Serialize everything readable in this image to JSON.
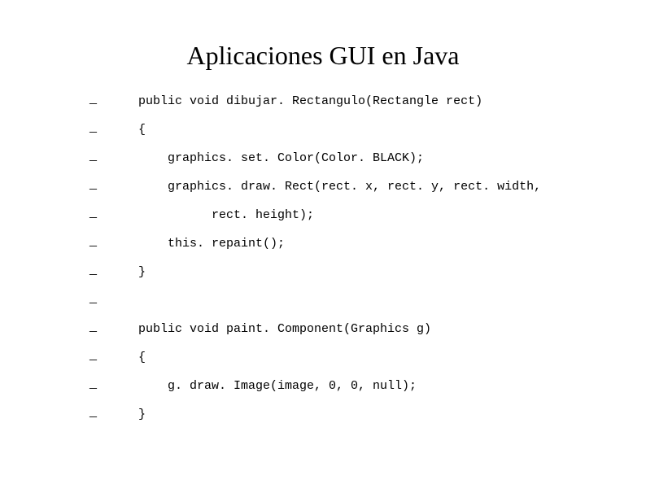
{
  "title": "Aplicaciones GUI en Java",
  "lines": [
    "public void dibujar. Rectangulo(Rectangle rect)",
    "{",
    "    graphics. set. Color(Color. BLACK);",
    "    graphics. draw. Rect(rect. x, rect. y, rect. width,",
    "          rect. height);",
    "    this. repaint();",
    "}",
    "",
    "public void paint. Component(Graphics g)",
    "{",
    "    g. draw. Image(image, 0, 0, null);",
    "}"
  ]
}
